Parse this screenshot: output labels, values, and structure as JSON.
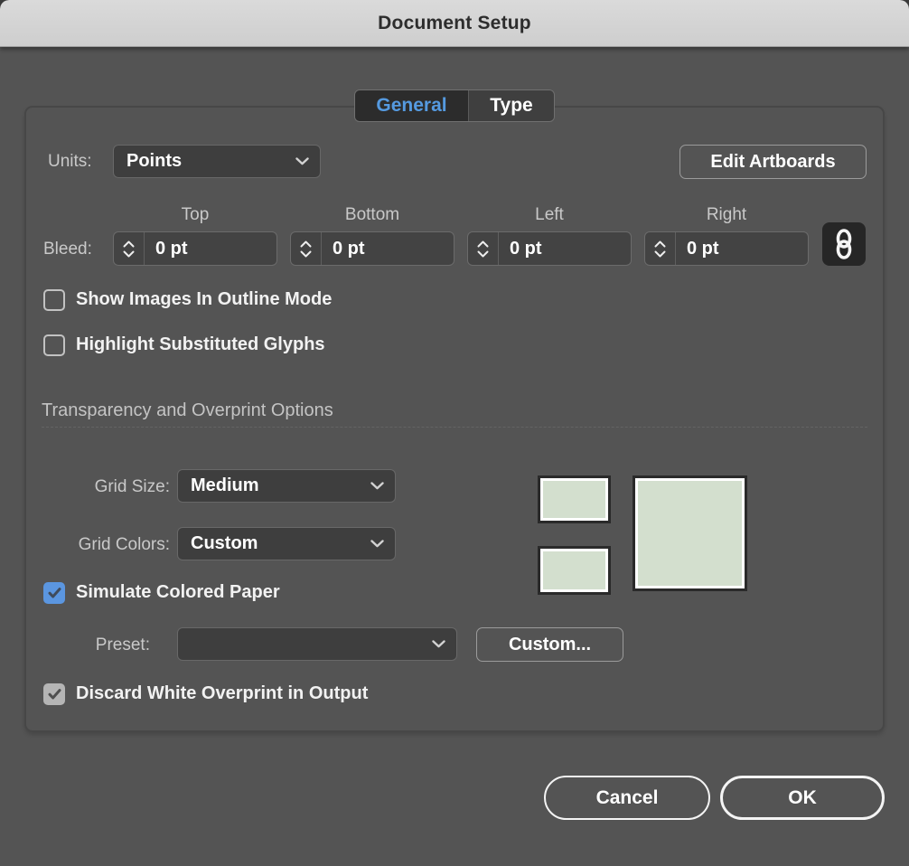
{
  "window": {
    "title": "Document Setup"
  },
  "tabs": {
    "general": "General",
    "type": "Type"
  },
  "general": {
    "units_label": "Units:",
    "units_value": "Points",
    "edit_artboards_button": "Edit Artboards",
    "bleed": {
      "label": "Bleed:",
      "columns": [
        "Top",
        "Bottom",
        "Left",
        "Right"
      ],
      "values": [
        "0 pt",
        "0 pt",
        "0 pt",
        "0 pt"
      ],
      "link_state": "linked"
    },
    "show_images_outline": {
      "label": "Show Images In Outline Mode",
      "checked": false
    },
    "highlight_glyphs": {
      "label": "Highlight Substituted Glyphs",
      "checked": false
    },
    "transparency_section": {
      "title": "Transparency and Overprint Options",
      "grid_size_label": "Grid Size:",
      "grid_size_value": "Medium",
      "grid_colors_label": "Grid Colors:",
      "grid_colors_value": "Custom",
      "simulate_colored_paper": {
        "label": "Simulate Colored Paper",
        "checked": true
      },
      "preset_label": "Preset:",
      "preset_value": "",
      "custom_button": "Custom...",
      "discard_white_overprint": {
        "label": "Discard White Overprint in Output",
        "checked": true
      }
    }
  },
  "footer": {
    "cancel_button": "Cancel",
    "ok_button": "OK"
  },
  "colors": {
    "dialog_bg": "#545454",
    "title_bar": "#d4d4d4",
    "accent_blue": "#5b96e0",
    "swatch_green": "#d3dfce",
    "tab_active_text": "#559ae0"
  },
  "icons": {
    "dropdown": "chevron-down-icon",
    "stepper": "up-down-chevrons-icon",
    "bleed_link": "link-icon",
    "checkbox_check": "check-icon"
  }
}
